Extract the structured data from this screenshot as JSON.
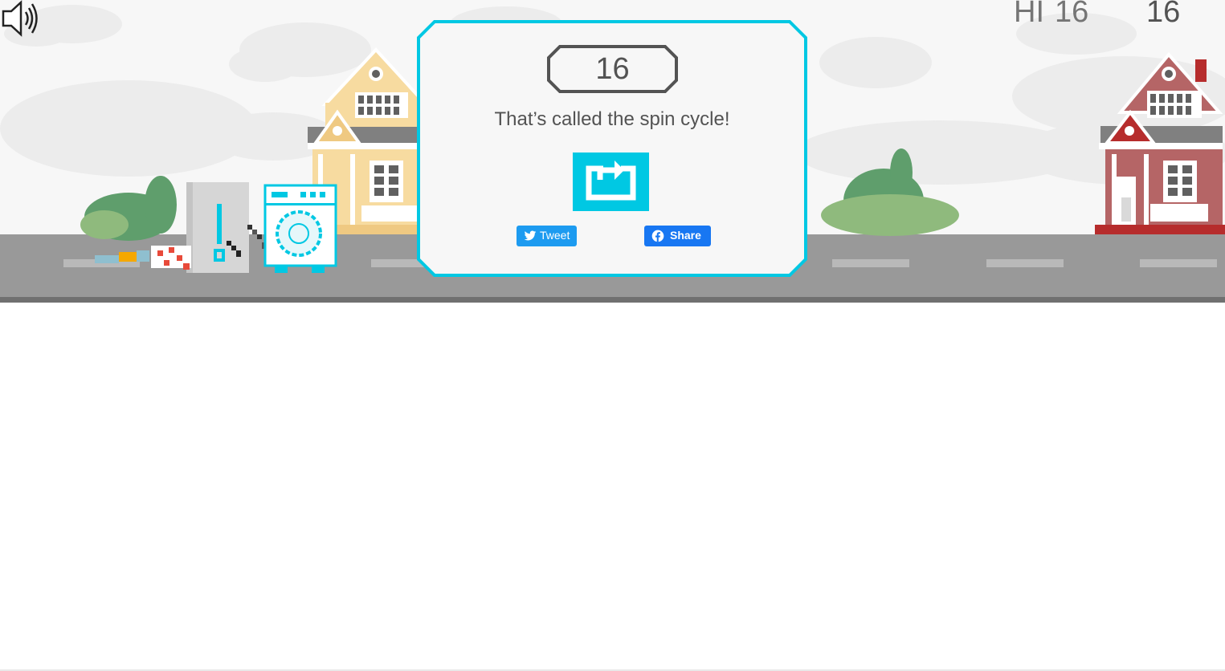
{
  "hud": {
    "hi_label": "HI",
    "hi_score": "16",
    "current_score": "16"
  },
  "game_over": {
    "score": "16",
    "message": "That’s called the spin cycle!",
    "tweet_label": "Tweet",
    "share_label": "Share"
  },
  "icons": {
    "sound": "speaker-sound-on-icon",
    "restart": "restart-icon",
    "tweet": "twitter-bird-icon",
    "share": "facebook-icon"
  },
  "colors": {
    "accent": "#00c8e3",
    "road": "#999999",
    "score_text": "#535353",
    "twitter": "#1d9bf0",
    "facebook": "#1877f2"
  }
}
